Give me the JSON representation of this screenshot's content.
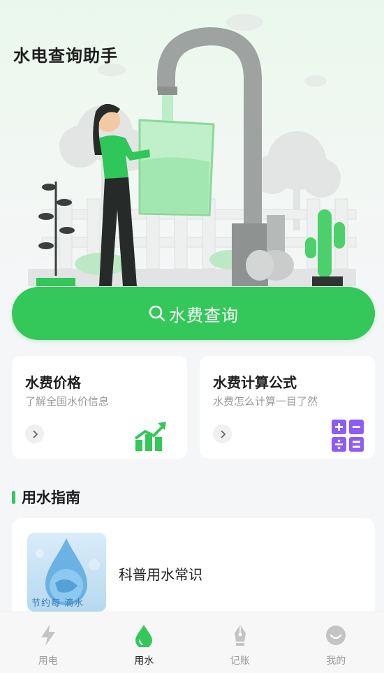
{
  "app": {
    "title": "水电查询助手"
  },
  "hero": {
    "query_button_label": "水费查询"
  },
  "cards": [
    {
      "title": "水费价格",
      "subtitle": "了解全国水价信息",
      "icon": "chart-up-icon",
      "color": "#34c759"
    },
    {
      "title": "水费计算公式",
      "subtitle": "水费怎么计算一目了然",
      "icon": "calculator-icon",
      "color": "#8b5cf6"
    }
  ],
  "guide": {
    "section_title": "用水指南",
    "items": [
      {
        "title": "科普用水常识",
        "thumb_caption": "节约每 滴水"
      }
    ]
  },
  "tabbar": {
    "tabs": [
      {
        "label": "用电",
        "icon": "lightning-icon",
        "active": false
      },
      {
        "label": "用水",
        "icon": "water-drop-icon",
        "active": true
      },
      {
        "label": "记账",
        "icon": "pen-nib-icon",
        "active": false
      },
      {
        "label": "我的",
        "icon": "smile-icon",
        "active": false
      }
    ]
  },
  "colors": {
    "accent": "#34c759",
    "purple": "#8b5cf6",
    "background": "#f5f6f8"
  }
}
